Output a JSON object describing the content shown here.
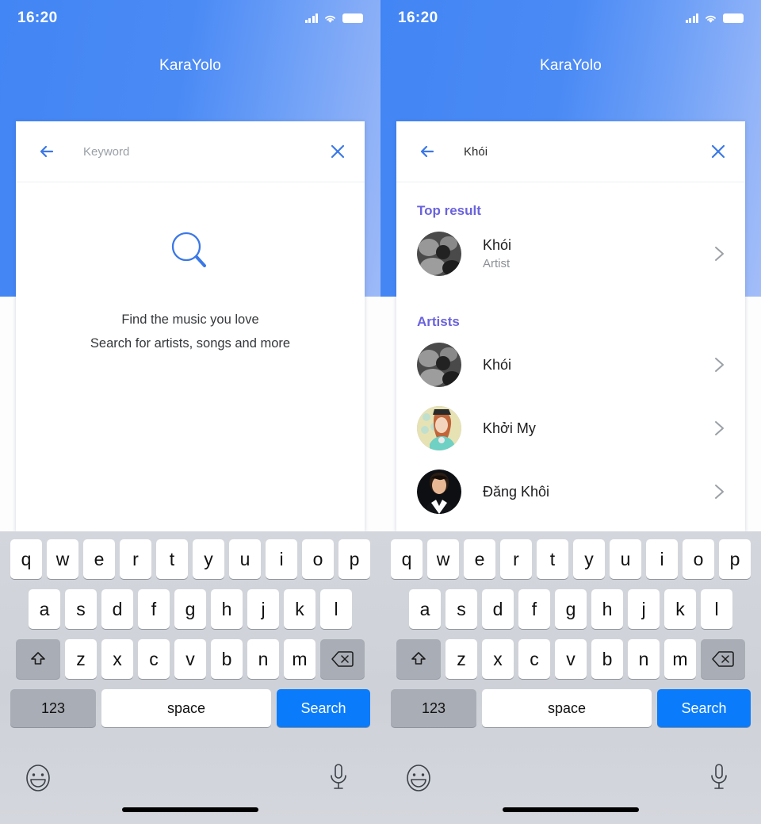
{
  "status": {
    "time": "16:20",
    "signal_icon": "cellular-signal-icon",
    "wifi_icon": "wifi-icon",
    "battery_icon": "battery-icon"
  },
  "app": {
    "title": "KaraYolo",
    "accent_blue": "#4285f4",
    "heading_purple": "#6a63dd",
    "key_blue": "#0a7cfb"
  },
  "left_panel": {
    "search": {
      "value": "",
      "placeholder": "Keyword",
      "back_icon": "back-arrow-icon",
      "clear_icon": "close-icon"
    },
    "empty_state": {
      "icon": "magnifier-icon",
      "line1": "Find the music you love",
      "line2": "Search for artists, songs and more"
    }
  },
  "right_panel": {
    "search": {
      "value": "Khói",
      "placeholder": "Keyword",
      "back_icon": "back-arrow-icon",
      "clear_icon": "close-icon"
    },
    "sections": [
      {
        "heading": "Top result",
        "rows": [
          {
            "title": "Khói",
            "subtitle": "Artist",
            "avatar": "artist-photo-khoi",
            "chevron": "chevron-right-icon"
          }
        ]
      },
      {
        "heading": "Artists",
        "rows": [
          {
            "title": "Khói",
            "subtitle": "",
            "avatar": "artist-photo-khoi",
            "chevron": "chevron-right-icon"
          },
          {
            "title": "Khởi My",
            "subtitle": "",
            "avatar": "artist-photo-khoimy",
            "chevron": "chevron-right-icon"
          },
          {
            "title": "Đăng Khôi",
            "subtitle": "",
            "avatar": "artist-photo-dangkhoi",
            "chevron": "chevron-right-icon"
          }
        ]
      }
    ]
  },
  "keyboard": {
    "row1": [
      "q",
      "w",
      "e",
      "r",
      "t",
      "y",
      "u",
      "i",
      "o",
      "p"
    ],
    "row2": [
      "a",
      "s",
      "d",
      "f",
      "g",
      "h",
      "j",
      "k",
      "l"
    ],
    "row3": [
      "z",
      "x",
      "c",
      "v",
      "b",
      "n",
      "m"
    ],
    "shift_icon": "shift-up-arrow-icon",
    "backspace_icon": "backspace-delete-icon",
    "numbers_label": "123",
    "space_label": "space",
    "action_label": "Search",
    "emoji_icon": "emoji-smiley-icon",
    "mic_icon": "microphone-icon",
    "home_indicator": "home-indicator-bar"
  }
}
